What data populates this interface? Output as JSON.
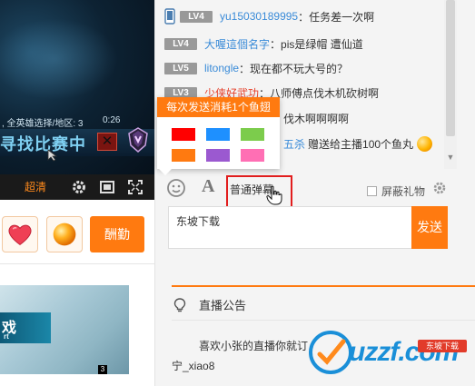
{
  "video": {
    "mode_text": ", 全英雄选择/地区: 3",
    "time_text": "0:26",
    "banner_text": "寻找比赛中",
    "close_symbol": "✕",
    "quality_label": "超清",
    "icons": [
      "settings-icon",
      "screen-mode-icon",
      "fullscreen-icon"
    ]
  },
  "gifts": {
    "items": [
      "heart-gift",
      "orange-ball-gift"
    ],
    "reward_label": "酬勤"
  },
  "thumbnail": {
    "title": "戏",
    "subtitle": "rt",
    "count": "3"
  },
  "chat": {
    "messages": [
      {
        "level": "LV4",
        "user": "yu15030189995",
        "text": "任务差一次啊",
        "mobile": true
      },
      {
        "level": "LV4",
        "user": "大喔這個名字",
        "text": "pis是绿帽 遭仙道",
        "mobile": false
      },
      {
        "level": "LV5",
        "user": "litongle",
        "text": "现在都不玩大号的？",
        "mobile": false
      },
      {
        "level": "LV3",
        "user": "少侠好武功",
        "text": "八师傅点伐木机砍树啊",
        "mobile": false
      },
      {
        "level": "",
        "user": "",
        "text": "伐木啊啊啊啊",
        "mobile": false
      },
      {
        "level": "",
        "user": "五杀",
        "text": "赠送给主播100个鱼丸",
        "mobile": false
      }
    ],
    "separator": "："
  },
  "color_popup": {
    "header": "每次发送消耗1个鱼翅",
    "colors": [
      "#ff0000",
      "#1e90ff",
      "#7ccc4c",
      "#ff7a10",
      "#9b59d0",
      "#ff6fb4"
    ]
  },
  "chat_tools": {
    "font_glyph": "A",
    "danmu_mode": "普通弹幕",
    "block_gift_label": "屏蔽礼物",
    "block_gift_checked": false
  },
  "input": {
    "value": "东坡下载",
    "send_label": "发送"
  },
  "notice": {
    "title": "直播公告",
    "body": "喜欢小张的直播你就订",
    "user": "宁_xiao8"
  },
  "watermark": {
    "text": "uzzf.com",
    "badge": "东坡下载"
  },
  "colors": {
    "accent": "#ff7a10",
    "username": "#3a8bd8",
    "highlight_user": "#e6402a",
    "focus_border": "#e21e1e"
  }
}
